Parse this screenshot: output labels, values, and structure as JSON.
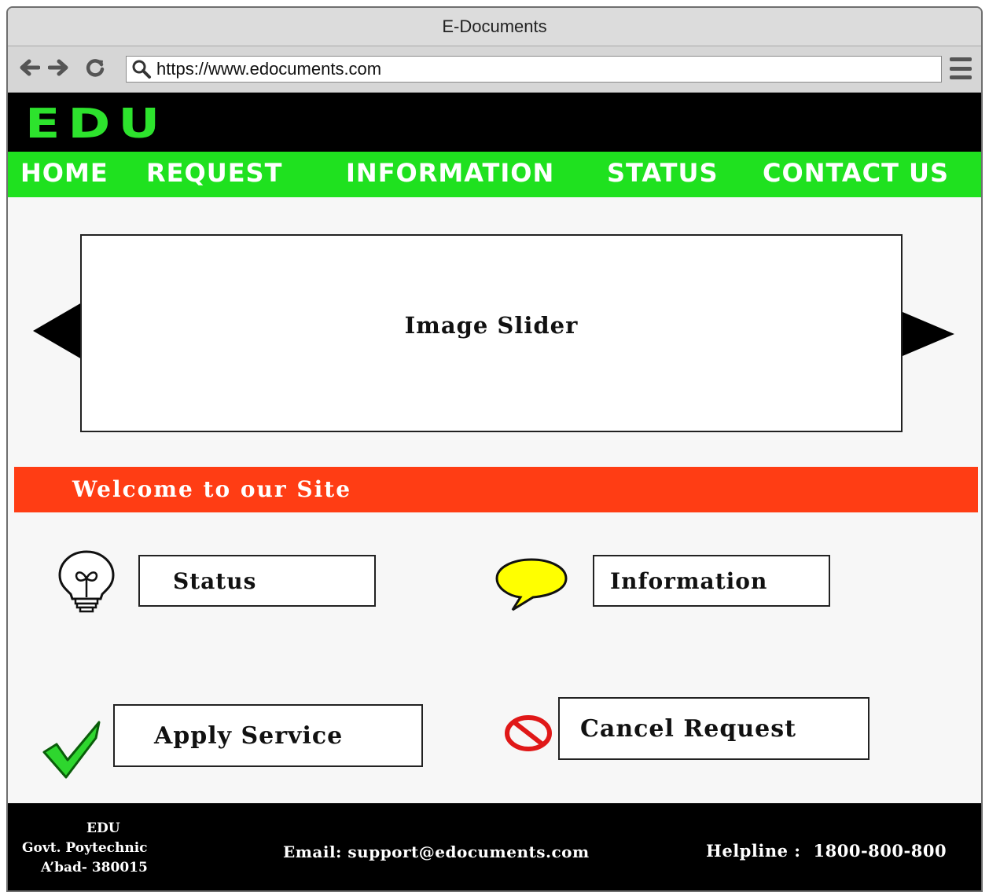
{
  "browser": {
    "window_title": "E-Documents",
    "url": "https://www.edocuments.com",
    "back_icon": "arrow-left-icon",
    "forward_icon": "arrow-right-icon",
    "reload_icon": "reload-icon",
    "search_icon": "search-icon",
    "menu_icon": "hamburger-menu-icon"
  },
  "header": {
    "logo": "EDU",
    "logo_color": "#2de32d",
    "nav": {
      "home": "HOME",
      "request": "REQUEST",
      "information": "INFORMATION",
      "status": "STATUS",
      "contact": "CONTACT US"
    },
    "nav_color": "#1fe11f"
  },
  "slider": {
    "label": "Image Slider",
    "prev_icon": "triangle-left-icon",
    "next_icon": "triangle-right-icon"
  },
  "welcome": {
    "text": "Welcome to our Site",
    "color": "#ff3d14"
  },
  "actions": {
    "status": {
      "label": "Status",
      "icon": "lightbulb-icon"
    },
    "information": {
      "label": "Information",
      "icon": "speech-bubble-icon"
    },
    "apply": {
      "label": "Apply Service",
      "icon": "checkmark-icon"
    },
    "cancel": {
      "label": "Cancel Request",
      "icon": "prohibited-icon"
    }
  },
  "footer": {
    "org_line1": "EDU",
    "org_line2": "Govt. Poytechnic",
    "org_line3": "A’bad- 380015",
    "email": "Email: support@edocuments.com",
    "helpline_label": "Helpline :",
    "helpline_number": "1800-800-800"
  }
}
